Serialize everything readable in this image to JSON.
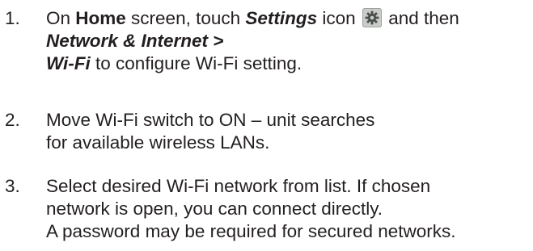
{
  "steps": [
    {
      "number": "1.",
      "line1": {
        "pre": "On ",
        "home": "Home",
        "mid": " screen, touch ",
        "settings": "Settings",
        "post_before_icon": " icon",
        "post_after_icon": "and then"
      },
      "line2": "Network & Internet >",
      "line3": {
        "wifi": "Wi-Fi",
        "rest": " to configure Wi-Fi setting."
      },
      "icon": "gear-settings-icon"
    },
    {
      "number": "2.",
      "line1": "Move Wi-Fi switch to ON – unit searches",
      "line2": "for available wireless LANs."
    },
    {
      "number": "3.",
      "line1": "Select desired Wi-Fi network from list.  If chosen",
      "line2": "network is open, you can connect directly.",
      "line3": "A password may be required for secured networks."
    }
  ]
}
